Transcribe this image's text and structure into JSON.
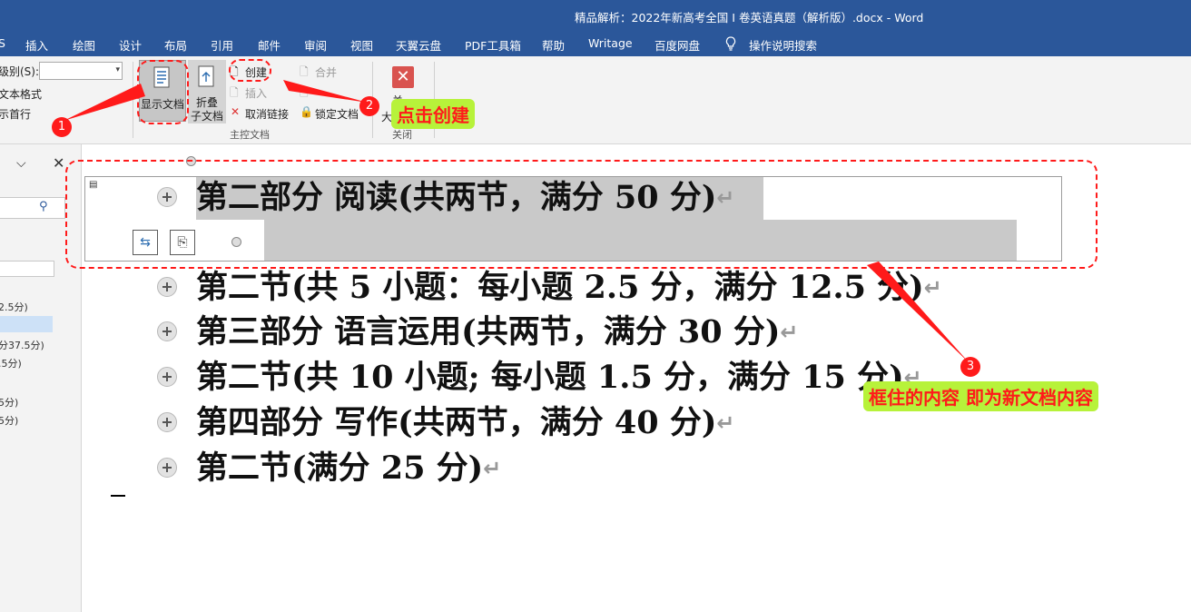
{
  "window": {
    "title": "精品解析：2022年新高考全国 I 卷英语真题（解析版）.docx  -  Word"
  },
  "menu": [
    {
      "label": "插入",
      "icon": ""
    },
    {
      "label": "绘图",
      "icon": ""
    },
    {
      "label": "设计",
      "icon": ""
    },
    {
      "label": "布局",
      "icon": ""
    },
    {
      "label": "引用",
      "icon": ""
    },
    {
      "label": "邮件",
      "icon": ""
    },
    {
      "label": "审阅",
      "icon": ""
    },
    {
      "label": "视图",
      "icon": ""
    },
    {
      "label": "天翼云盘",
      "icon": ""
    },
    {
      "label": "PDF工具箱",
      "icon": ""
    },
    {
      "label": "帮助",
      "icon": ""
    },
    {
      "label": "Writage",
      "icon": ""
    },
    {
      "label": "百度网盘",
      "icon": ""
    },
    {
      "label": "操作说明搜索",
      "icon": "lightbulb-icon"
    }
  ],
  "ribbon": {
    "level_label": "级别(S):",
    "level_value": "",
    "show_text_format": "文本格式",
    "show_first_line": "示首行",
    "show_document": "显示文档",
    "collapse_subdocs": "折叠\n子文档",
    "create": "创建",
    "insert": "插入",
    "unlink": "取消链接",
    "merge": "合并",
    "lock_document": "锁定文档",
    "group_master": "主控文档",
    "close_partial": "关",
    "close_partial2": "大",
    "close_partial3": "关闭"
  },
  "left_pane": {
    "items": [
      "2.5分)",
      "分37.5分)",
      ".5分)",
      "5分)",
      "5分)"
    ]
  },
  "document": {
    "headings": [
      "第二部分  阅读(共两节，满分 50 分)",
      "第二节(共 5 小题：每小题 2.5 分，满分 12.5 分)",
      "第三部分  语言运用(共两节，满分 30 分)",
      "第二节(共 10 小题; 每小题 1.5 分，满分 15 分)",
      "第四部分  写作(共两节，满分 40 分)",
      "第二节(满分 25 分)"
    ],
    "para_mark": "↵"
  },
  "annotations": {
    "n1": "1",
    "n2": "2",
    "n3": "3",
    "callout_create": "点击创建",
    "callout_content": "框住的内容 即为新文档内容",
    "color": "#ff1a1a",
    "callout_bg": "#b7f23a"
  }
}
